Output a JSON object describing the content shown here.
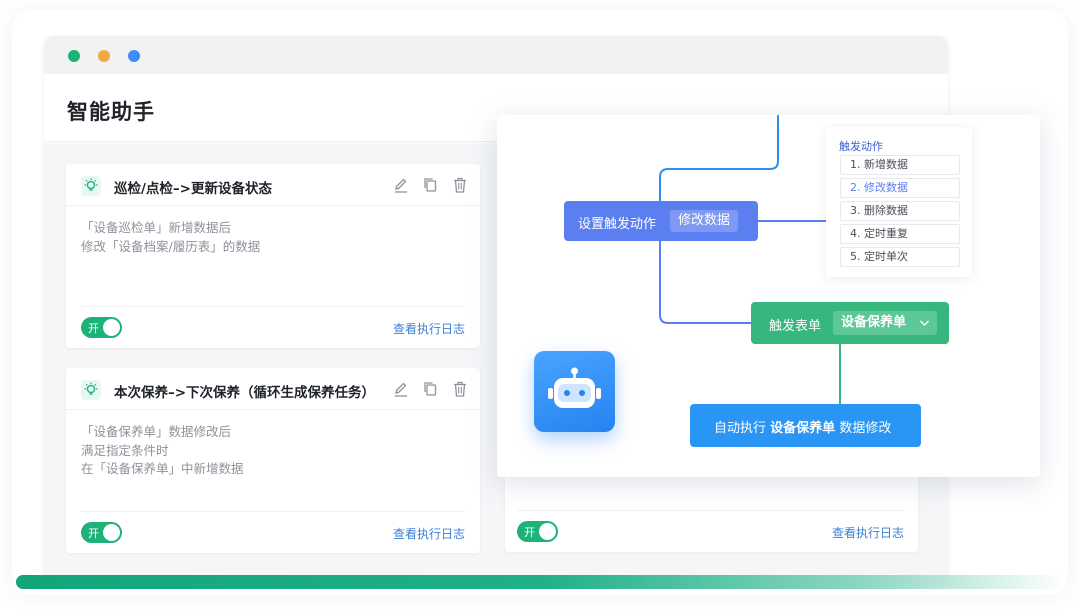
{
  "app": {
    "title": "智能助手"
  },
  "window_controls": [
    "close",
    "minimize",
    "maximize"
  ],
  "cards": [
    {
      "title": "巡检/点检–>更新设备状态",
      "body_lines": [
        "「设备巡检单」新增数据后",
        "修改「设备档案/履历表」的数据"
      ],
      "toggle_label": "开",
      "toggle_on": true,
      "log_link": "查看执行日志"
    },
    {
      "title": "本次保养–>下次保养（循环生成保养任务）",
      "body_lines": [
        "「设备保养单」数据修改后",
        "满足指定条件时",
        "在「设备保养单」中新增数据"
      ],
      "toggle_label": "开",
      "toggle_on": true,
      "log_link": "查看执行日志"
    },
    {
      "toggle_label": "开",
      "toggle_on": true,
      "log_link": "查看执行日志"
    }
  ],
  "flow": {
    "set_trigger": {
      "label": "设置触发动作",
      "value": "修改数据"
    },
    "trigger_form": {
      "label": "触发表单",
      "value": "设备保养单"
    },
    "auto_exec": {
      "prefix": "自动执行",
      "form": "设备保养单",
      "suffix": "数据修改"
    },
    "trigger_panel": {
      "title": "触发动作",
      "options": [
        "1. 新增数据",
        "2. 修改数据",
        "3. 删除数据",
        "4. 定时重复",
        "5. 定时单次"
      ],
      "selected_index": 1
    }
  },
  "colors": {
    "green": "#1db278",
    "blue_node": "#5b7ff0",
    "green_node": "#35b77e",
    "auto_node": "#2995f5",
    "link": "#3b7fd6"
  },
  "icons": {
    "card_icon": "lightbulb-icon",
    "edit": "edit-icon",
    "copy": "copy-icon",
    "delete": "trash-icon",
    "robot": "robot-icon"
  }
}
